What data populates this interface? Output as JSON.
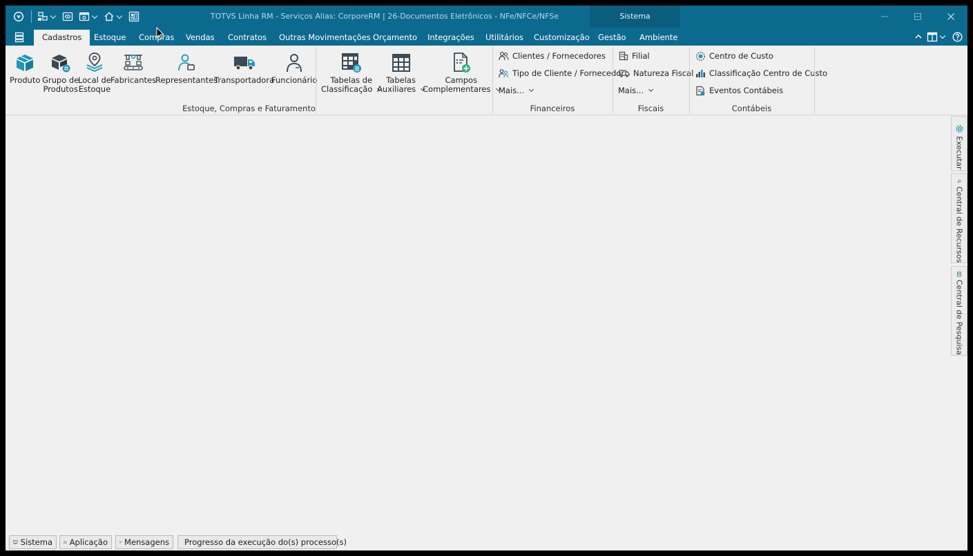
{
  "window": {
    "title": "TOTVS Linha RM - Serviços  Alias: CorporeRM | 26-Documentos Eletrônicos - NFe/NFCe/NFSe",
    "context_tab": "Sistema"
  },
  "menu": {
    "tabs": [
      "Cadastros",
      "Estoque",
      "Compras",
      "Vendas",
      "Contratos",
      "Outras Movimentações",
      "Orçamento",
      "Integrações",
      "Utilitários",
      "Customização",
      "Gestão",
      "Ambiente"
    ],
    "active": "Cadastros"
  },
  "ribbon": {
    "estoque_group": {
      "label": "Estoque, Compras e Faturamento",
      "buttons": [
        {
          "line1": "Produto",
          "line2": ""
        },
        {
          "line1": "Grupo de",
          "line2": "Produtos"
        },
        {
          "line1": "Local de",
          "line2": "Estoque"
        },
        {
          "line1": "Fabricantes",
          "line2": ""
        },
        {
          "line1": "Representantes",
          "line2": ""
        },
        {
          "line1": "Transportadora",
          "line2": ""
        },
        {
          "line1": "Funcionário",
          "line2": ""
        },
        {
          "line1": "Tabelas de",
          "line2": "Classificação"
        },
        {
          "line1": "Tabelas",
          "line2": "Auxiliares"
        },
        {
          "line1": "Campos",
          "line2": "Complementares"
        }
      ]
    },
    "financeiros": {
      "label": "Financeiros",
      "items": [
        "Clientes / Fornecedores",
        "Tipo de Cliente / Fornecedor"
      ],
      "more": "Mais..."
    },
    "fiscais": {
      "label": "Fiscais",
      "items": [
        "Filial",
        "Natureza Fiscal"
      ],
      "more": "Mais..."
    },
    "contabeis": {
      "label": "Contábeis",
      "items": [
        "Centro de Custo",
        "Classificação Centro de Custo",
        "Eventos Contábeis"
      ]
    }
  },
  "side_panels": [
    "Executar",
    "Central de Recursos",
    "Central de Pesquisa"
  ],
  "statusbar": [
    "Sistema",
    "Aplicação",
    "Mensagens",
    "Progresso da execução do(s) processo(s)"
  ],
  "colors": {
    "titlebar": "#0d6a8f",
    "accent": "#1f97b8",
    "icon_dark": "#3d4a55",
    "plus_green": "#2db37a"
  }
}
